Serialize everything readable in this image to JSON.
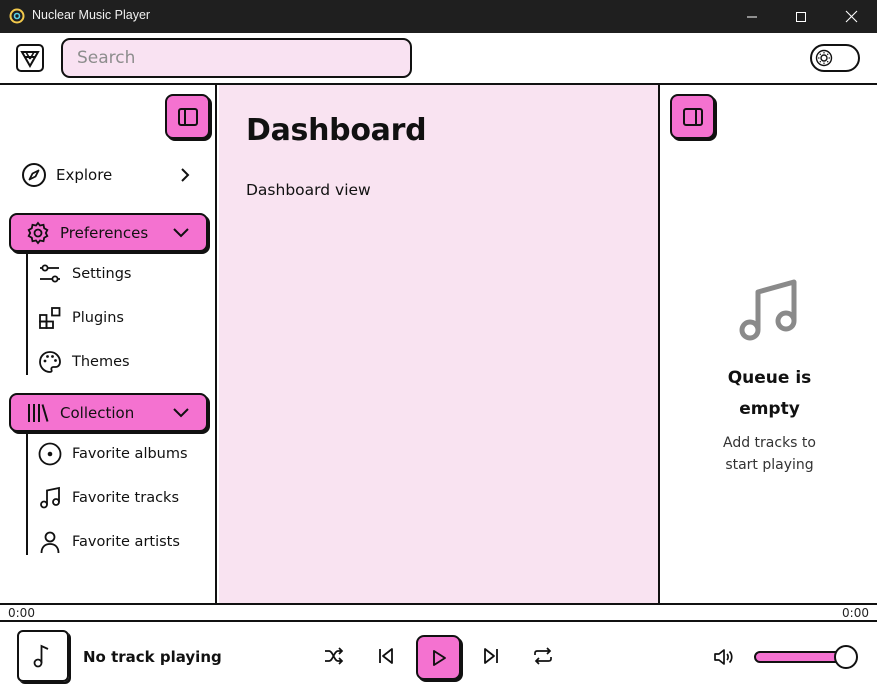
{
  "window": {
    "title": "Nuclear Music Player"
  },
  "search": {
    "placeholder": "Search",
    "value": ""
  },
  "sidebar": {
    "explore_label": "Explore",
    "groups": [
      {
        "label": "Preferences",
        "items": [
          {
            "label": "Settings",
            "icon": "sliders-icon"
          },
          {
            "label": "Plugins",
            "icon": "plugins-icon"
          },
          {
            "label": "Themes",
            "icon": "palette-icon"
          }
        ]
      },
      {
        "label": "Collection",
        "items": [
          {
            "label": "Favorite albums",
            "icon": "disc-icon"
          },
          {
            "label": "Favorite tracks",
            "icon": "music-note-icon"
          },
          {
            "label": "Favorite artists",
            "icon": "user-icon"
          }
        ]
      }
    ]
  },
  "main": {
    "title": "Dashboard",
    "body": "Dashboard view"
  },
  "queue": {
    "title_line1": "Queue is",
    "title_line2": "empty",
    "subtitle_line1": "Add tracks to",
    "subtitle_line2": "start playing"
  },
  "progress": {
    "elapsed": "0:00",
    "total": "0:00"
  },
  "player": {
    "track": "No track playing",
    "volume_fraction": 1.0
  },
  "colors": {
    "accent": "#f472d0",
    "main_bg": "#f9e3f1",
    "titlebar": "#1f1f1f",
    "border": "#111111"
  }
}
